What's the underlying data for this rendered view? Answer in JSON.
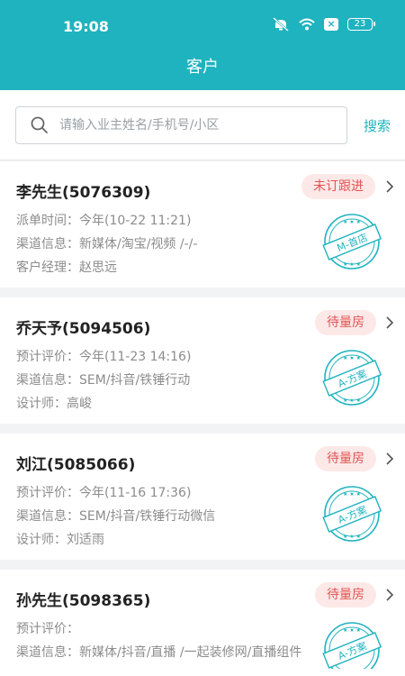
{
  "status": {
    "time": "19:08",
    "battery": "23"
  },
  "header": {
    "title": "客户"
  },
  "search": {
    "placeholder": "请输入业主姓名/手机号/小区",
    "button": "搜索"
  },
  "customers": [
    {
      "name": "李先生(5076309)",
      "status": "未订跟进",
      "lines": [
        {
          "label": "派单时间：",
          "value": "今年(10-22 11:21)"
        },
        {
          "label": "渠道信息：",
          "value": "新媒体/淘宝/视频 /-/-"
        },
        {
          "label": "客户经理：",
          "value": "赵思远"
        }
      ],
      "stamp": "M-首店"
    },
    {
      "name": "乔天予(5094506)",
      "status": "待量房",
      "lines": [
        {
          "label": "预计评价：",
          "value": "今年(11-23 14:16)"
        },
        {
          "label": "渠道信息：",
          "value": "SEM/抖音/铁锤行动"
        },
        {
          "label": "设计师：",
          "value": "高峻"
        }
      ],
      "stamp": "A-方案"
    },
    {
      "name": "刘江(5085066)",
      "status": "待量房",
      "lines": [
        {
          "label": "预计评价：",
          "value": "今年(11-16 17:36)"
        },
        {
          "label": "渠道信息：",
          "value": "SEM/抖音/铁锤行动微信"
        },
        {
          "label": "设计师：",
          "value": "刘适雨"
        }
      ],
      "stamp": "A-方案"
    },
    {
      "name": "孙先生(5098365)",
      "status": "待量房",
      "lines": [
        {
          "label": "预计评价：",
          "value": ""
        },
        {
          "label": "渠道信息：",
          "value": "新媒体/抖音/直播 /一起装修网/直播组件"
        },
        {
          "label": "",
          "value": ""
        }
      ],
      "stamp": "A-方案"
    }
  ],
  "colors": {
    "primary": "#1fb3bf",
    "badge_bg": "#fde8e8",
    "badge_text": "#e45353",
    "stamp": "#1fb3bf"
  }
}
